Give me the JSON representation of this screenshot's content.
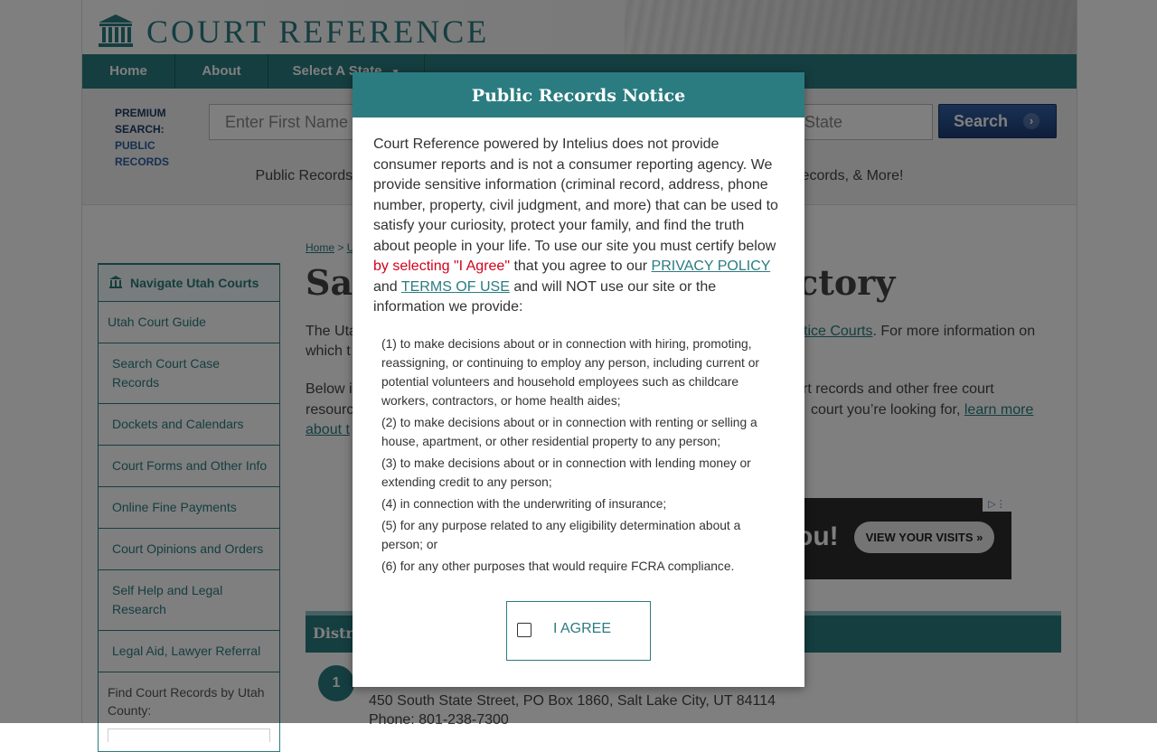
{
  "site": {
    "logo_text": "COURT REFERENCE"
  },
  "nav": [
    {
      "label": "Home"
    },
    {
      "label": "About"
    },
    {
      "label": "Select A State"
    }
  ],
  "search": {
    "premium_line1": "PREMIUM",
    "premium_line2": "SEARCH:",
    "premium_line3": "PUBLIC",
    "premium_line4": "RECORDS",
    "first_name_placeholder": "Enter First Name",
    "state_placeholder": "State",
    "button_label": "Search",
    "tagline": "Public Records Search - Y                                                                              Divorce Records, & More!"
  },
  "sidebar": {
    "header": "Navigate Utah Courts",
    "items": [
      {
        "label": "Utah Court Guide"
      },
      {
        "label": "Search Court Case Records"
      },
      {
        "label": "Dockets and Calendars"
      },
      {
        "label": "Court Forms and Other Info"
      },
      {
        "label": "Online Fine Payments"
      },
      {
        "label": "Court Opinions and Orders"
      },
      {
        "label": "Self Help and Legal Research"
      },
      {
        "label": "Legal Aid, Lawyer Referral"
      }
    ],
    "find_label": "Find Court Records by Utah County:"
  },
  "main": {
    "breadcrumb_home": "Home",
    "breadcrumb_sep": " > ",
    "breadcrumb_next": "U",
    "title_left": "Sal",
    "title_right": "ectory",
    "p1_start": "The Uta",
    "p1_link": "stice Courts",
    "p1_end": ". For more information on",
    "p1_line2": "which t",
    "p2_start": "Below i",
    "p2_right": "rt records and other free court",
    "p2_line2_left": "resourc",
    "p2_line2_right": "court you’re looking for, ",
    "p2_link1": "learn more",
    "p2_link2": "about t",
    "district_label": "Distric",
    "entry_number": "1",
    "address": "450 South State Street, PO Box 1860, Salt Lake City, UT 84114",
    "phone": "Phone: 801-238-7300"
  },
  "ad": {
    "big_text": "ou!",
    "button": "VIEW YOUR VISITS »"
  },
  "modal": {
    "title": "Public Records Notice",
    "intro_1": "Court Reference powered by Intelius does not provide consumer reports and is not a consumer reporting agency. We provide sensitive information (criminal record, address, phone number, property, civil judgment, and more) that can be used to satisfy your curiosity, protect your family, and find the truth about people in your life. To use our site you must certify below ",
    "intro_red": "by selecting \"I Agree\"",
    "intro_2": " that you agree to our ",
    "privacy_link": "PRIVACY POLICY",
    "intro_3": " and ",
    "terms_link": "TERMS OF USE",
    "intro_4": " and will NOT use our site or the information we provide:",
    "clauses": [
      "(1) to make decisions about or in connection with hiring, promoting, reassigning, or continuing to employ any person, including current or potential volunteers and household employees such as childcare workers, contractors, or home health aides;",
      "(2) to make decisions about or in connection with renting or selling a house, apartment, or other residential property to any person;",
      "(3) to make decisions about or in connection with lending money or extending credit to any person;",
      "(4) in connection with the underwriting of insurance;",
      "(5) for any purpose related to any eligibility determination about a person; or",
      "(6) for any other purposes that would require FCRA compliance."
    ],
    "agree_label": "I AGREE"
  }
}
